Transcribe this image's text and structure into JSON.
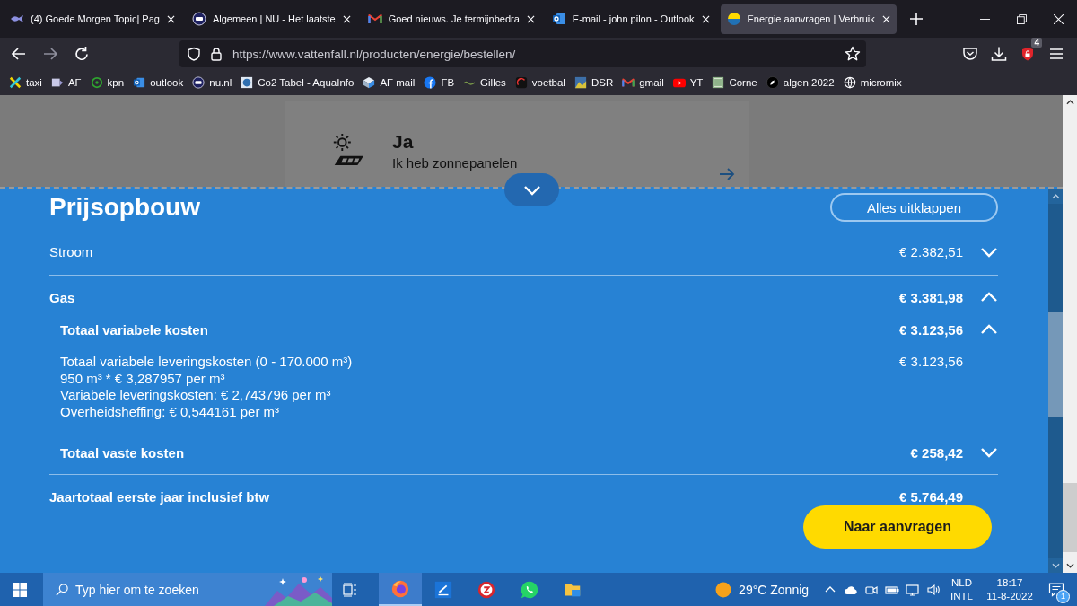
{
  "browser": {
    "tabs": [
      {
        "title": "(4) Goede Morgen Topic| Pag",
        "selected": false
      },
      {
        "title": "Algemeen | NU - Het laatste",
        "selected": false
      },
      {
        "title": "Goed nieuws. Je termijnbedra",
        "selected": false
      },
      {
        "title": "E-mail - john pilon - Outlook",
        "selected": false
      },
      {
        "title": "Energie aanvragen | Verbruik",
        "selected": true
      }
    ],
    "nav_buttons": [
      {
        "kind": "back",
        "disabled": false
      },
      {
        "kind": "forward",
        "disabled": true
      },
      {
        "kind": "reload",
        "disabled": false
      }
    ],
    "url": "https://www.vattenfall.nl/producten/energie/bestellen/",
    "extension_badge": "4",
    "bookmarks": [
      {
        "label": "taxi"
      },
      {
        "label": "AF"
      },
      {
        "label": "kpn"
      },
      {
        "label": "outlook"
      },
      {
        "label": "nu.nl"
      },
      {
        "label": "Co2 Tabel - AquaInfo"
      },
      {
        "label": "AF mail"
      },
      {
        "label": "FB"
      },
      {
        "label": "Gilles"
      },
      {
        "label": "voetbal"
      },
      {
        "label": "DSR"
      },
      {
        "label": "gmail"
      },
      {
        "label": "YT"
      },
      {
        "label": "Corne"
      },
      {
        "label": "algen 2022"
      },
      {
        "label": "micromix"
      }
    ]
  },
  "page": {
    "option": {
      "title": "Ja",
      "subtitle": "Ik heb zonnepanelen"
    },
    "header_toggle": {
      "expanded": false
    },
    "section_title": "Prijsopbouw",
    "expand_all": "Alles uitklappen",
    "rows": [
      {
        "label": "Stroom",
        "amount": "€ 2.382,51",
        "expanded": false
      },
      {
        "label": "Gas",
        "amount": "€ 3.381,98",
        "expanded": true,
        "children": [
          {
            "label": "Totaal variabele kosten",
            "amount": "€ 3.123,56",
            "expanded": true,
            "details": [
              "Totaal variabele leveringskosten (0 - 170.000 m³)",
              "950 m³ * € 3,287957 per m³",
              "Variabele leveringskosten: € 2,743796 per m³",
              "Overheidsheffing: € 0,544161 per m³"
            ],
            "detail_amount": "€ 3.123,56"
          },
          {
            "label": "Totaal vaste kosten",
            "amount": "€ 258,42",
            "expanded": false
          }
        ]
      }
    ],
    "total": {
      "label": "Jaartotaal eerste jaar inclusief btw",
      "amount": "€ 5.764,49"
    },
    "cta": "Naar aanvragen"
  },
  "taskbar": {
    "search": {
      "placeholder": "Typ hier om te zoeken"
    },
    "apps": [
      {
        "selected": true
      },
      {
        "selected": false
      },
      {
        "selected": false
      },
      {
        "selected": false
      },
      {
        "selected": false
      }
    ],
    "weather": "29°C Zonnig",
    "language": [
      "NLD",
      "INTL"
    ],
    "time": "18:17",
    "date": "11-8-2022",
    "notifications": "1"
  }
}
